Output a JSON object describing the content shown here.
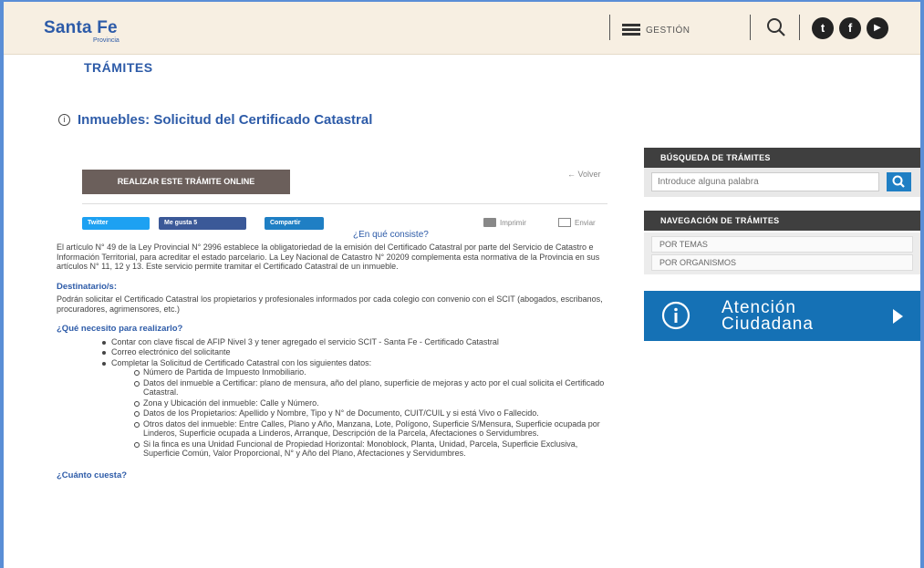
{
  "header": {
    "logo_main": "Santa Fe",
    "logo_sub": "Provincia",
    "menu_label": "GESTIÓN",
    "social": {
      "twitter": "t",
      "facebook": "f",
      "youtube": "▶"
    }
  },
  "breadcrumb": {
    "section": "TRÁMITES"
  },
  "page": {
    "title": "Inmuebles: Solicitud del Certificado Catastral",
    "online_button": "REALIZAR ESTE TRÁMITE ONLINE",
    "volver": "← Volver",
    "share": {
      "twitter": "Twitter",
      "like": "Me gusta 5",
      "share": "Compartir"
    },
    "print": "Imprimir",
    "send": "Enviar"
  },
  "content": {
    "consiste_title": "¿En qué consiste?",
    "consiste_text": "El artículo N° 49 de la Ley Provincial N° 2996 establece la obligatoriedad de la emisión del Certificado Catastral por parte del Servicio de Catastro e Información Territorial, para acreditar el estado parcelario. La Ley Nacional de Catastro N° 20209 complementa esta normativa de la Provincia en sus artículos N° 11, 12 y 13. Este servicio permite tramitar el Certificado Catastral de un inmueble.",
    "destinatarios_title": "Destinatario/s:",
    "destinatarios_text": "Podrán solicitar el Certificado Catastral los propietarios y profesionales informados por cada colegio con convenio con el SCIT (abogados, escribanos, procuradores, agrimensores, etc.)",
    "necesito_title": "¿Qué necesito para realizarlo?",
    "necesito_items": [
      "Contar con clave fiscal de AFIP Nivel 3 y tener agregado el servicio SCIT - Santa Fe - Certificado Catastral",
      "Correo electrónico del solicitante",
      "Completar la Solicitud de Certificado Catastral con los siguientes datos:"
    ],
    "datos_items": [
      "Número de Partida de Impuesto Inmobiliario.",
      "Datos del inmueble a Certificar: plano de mensura, año del plano, superficie de mejoras y acto por el cual solicita el Certificado Catastral.",
      "Zona y Ubicación del inmueble: Calle y Número.",
      "Datos de los Propietarios: Apellido y Nombre, Tipo y N° de Documento, CUIT/CUIL y si está Vivo o Fallecido.",
      "Otros datos del inmueble: Entre Calles, Plano y Año, Manzana, Lote, Polígono, Superficie S/Mensura, Superficie ocupada por Linderos, Superficie ocupada a Linderos, Arranque, Descripción de la Parcela, Afectaciones o Servidumbres.",
      "Si la finca es una Unidad Funcional de Propiedad Horizontal: Monoblock, Planta, Unidad, Parcela, Superficie Exclusiva, Superficie Común, Valor Proporcional, N° y Año del Plano, Afectaciones y Servidumbres."
    ],
    "cuesta_title": "¿Cuánto cuesta?"
  },
  "sidebar": {
    "busqueda_title": "BÚSQUEDA DE TRÁMITES",
    "search_placeholder": "Introduce alguna palabra",
    "navegacion_title": "NAVEGACIÓN DE TRÁMITES",
    "nav_items": [
      "POR TEMAS",
      "POR ORGANISMOS"
    ],
    "atencion_line1": "Atención",
    "atencion_line2": "Ciudadana"
  },
  "colors": {
    "brand_blue": "#2d5ba8",
    "header_bg": "#f7efe2",
    "button_brown": "#6b5f5b",
    "sidebar_dark": "#3f3f3f",
    "atencion_blue": "#1571b5",
    "twitter": "#1da1f2",
    "facebook": "#3b5998"
  }
}
